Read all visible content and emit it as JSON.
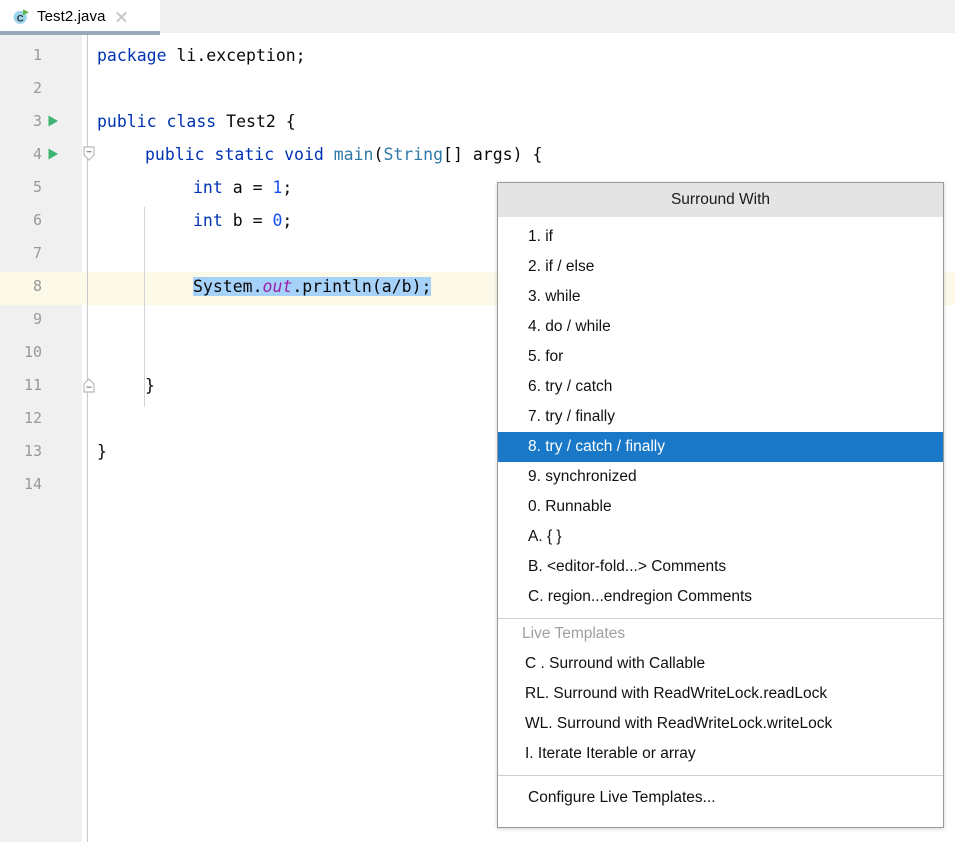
{
  "window": {
    "app": "IntelliJ IDEA Editor"
  },
  "tab": {
    "label": "Test2.java",
    "icon": "java-class-icon",
    "close_icon": "close-icon"
  },
  "editor": {
    "language": "java",
    "caret_line": 8,
    "selection_line": 8,
    "selection_text": "System.out.println(a/b);",
    "lines": [
      {
        "number": "1",
        "gutter": "",
        "fold": ""
      },
      {
        "number": "2",
        "gutter": "",
        "fold": ""
      },
      {
        "number": "3",
        "gutter": "run",
        "fold": ""
      },
      {
        "number": "4",
        "gutter": "run",
        "fold": "collapse"
      },
      {
        "number": "5",
        "gutter": "",
        "fold": ""
      },
      {
        "number": "6",
        "gutter": "",
        "fold": ""
      },
      {
        "number": "7",
        "gutter": "",
        "fold": ""
      },
      {
        "number": "8",
        "gutter": "",
        "fold": ""
      },
      {
        "number": "9",
        "gutter": "",
        "fold": ""
      },
      {
        "number": "10",
        "gutter": "",
        "fold": ""
      },
      {
        "number": "11",
        "gutter": "",
        "fold": "collapse-end"
      },
      {
        "number": "12",
        "gutter": "",
        "fold": ""
      },
      {
        "number": "13",
        "gutter": "",
        "fold": ""
      },
      {
        "number": "14",
        "gutter": "",
        "fold": ""
      }
    ],
    "code": {
      "l1_kw": "package",
      "l1_rest": " li.exception;",
      "l3_kw1": "public",
      "l3_kw2": " class ",
      "l3_name": "Test2",
      "l3_rest": " {",
      "l4_kw": "public static void ",
      "l4_method": "main",
      "l4_paren_open": "(",
      "l4_type": "String",
      "l4_rest": "[] args) {",
      "l5_type": "int",
      "l5_mid": " a = ",
      "l5_num": "1",
      "l5_end": ";",
      "l6_type": "int",
      "l6_mid": " b = ",
      "l6_num": "0",
      "l6_end": ";",
      "l8_pre": "System.",
      "l8_static": "out",
      "l8_post": ".println(a/b);",
      "l11_brace": "}",
      "l13_brace": "}"
    }
  },
  "popup": {
    "title": "Surround With",
    "items": [
      {
        "label": "1. if",
        "selected": false
      },
      {
        "label": "2. if / else",
        "selected": false
      },
      {
        "label": "3. while",
        "selected": false
      },
      {
        "label": "4. do / while",
        "selected": false
      },
      {
        "label": "5. for",
        "selected": false
      },
      {
        "label": "6. try / catch",
        "selected": false
      },
      {
        "label": "7. try / finally",
        "selected": false
      },
      {
        "label": "8. try / catch / finally",
        "selected": true
      },
      {
        "label": "9. synchronized",
        "selected": false
      },
      {
        "label": "0. Runnable",
        "selected": false
      },
      {
        "label": "A. { }",
        "selected": false
      },
      {
        "label": "B. <editor-fold...> Comments",
        "selected": false
      },
      {
        "label": "C. region...endregion Comments",
        "selected": false
      }
    ],
    "section_title": "Live Templates",
    "templates": [
      {
        "label": "C . Surround with Callable"
      },
      {
        "label": "RL. Surround with ReadWriteLock.readLock"
      },
      {
        "label": "WL. Surround with ReadWriteLock.writeLock"
      },
      {
        "label": "I. Iterate Iterable or array"
      }
    ],
    "footer": "Configure Live Templates...",
    "colors": {
      "selection_bg": "#1978c8",
      "selection_fg": "#ffffff",
      "header_bg": "#e4e4e4",
      "section_fg": "#a0a0a0"
    }
  }
}
